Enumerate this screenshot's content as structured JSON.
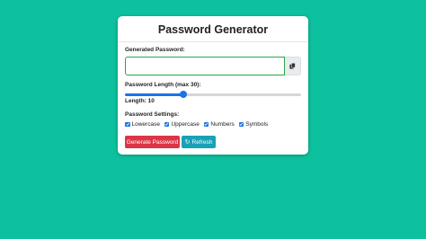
{
  "colors": {
    "background": "#0dc19f",
    "primary": "#1a73e8",
    "danger": "#dc3545",
    "info": "#17a2b8",
    "success_border": "#28a745"
  },
  "header": {
    "title": "Password Generator"
  },
  "password": {
    "label": "Generated Password:",
    "value": "",
    "copy_icon": "copy-icon"
  },
  "length": {
    "label": "Password Length (max 30):",
    "value": 10,
    "max": 30,
    "display": "Length: 10"
  },
  "settings": {
    "label": "Password Settings:",
    "options": [
      {
        "label": "Lowercase",
        "checked": true
      },
      {
        "label": "Uppercase",
        "checked": true
      },
      {
        "label": "Numbers",
        "checked": true
      },
      {
        "label": "Symbols",
        "checked": true
      }
    ]
  },
  "buttons": {
    "generate": "Generate Password",
    "refresh": "Refresh",
    "refresh_icon": "refresh-icon"
  }
}
